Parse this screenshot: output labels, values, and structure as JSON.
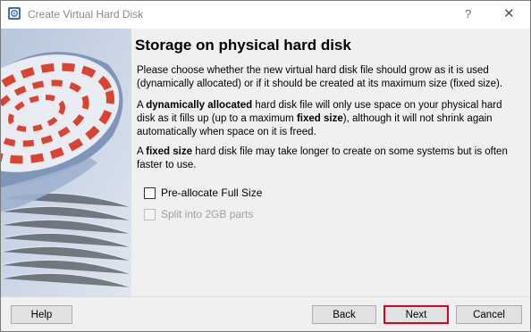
{
  "window": {
    "title": "Create Virtual Hard Disk",
    "help_glyph": "?",
    "close_glyph": "✕",
    "icon": "virtualbox-app-icon"
  },
  "page": {
    "heading": "Storage on physical hard disk",
    "paragraph1": "Please choose whether the new virtual hard disk file should grow as it is used (dynamically allocated) or if it should be created at its maximum size (fixed size).",
    "paragraph2": {
      "t1": "A ",
      "b1": "dynamically allocated",
      "t2": " hard disk file will only use space on your physical hard disk as it fills up (up to a maximum ",
      "b2": "fixed size",
      "t3": "), although it will not shrink again automatically when space on it is freed."
    },
    "paragraph3": {
      "t1": "A ",
      "b1": "fixed size",
      "t2": " hard disk file may take longer to create on some systems but is often faster to use."
    },
    "options": {
      "preallocate": {
        "label": "Pre-allocate Full Size",
        "checked": false,
        "enabled": true
      },
      "split": {
        "label": "Split into 2GB parts",
        "checked": false,
        "enabled": false
      }
    }
  },
  "buttons": {
    "help": "Help",
    "back": "Back",
    "next": "Next",
    "cancel": "Cancel"
  },
  "colors": {
    "highlight": "#e0001b",
    "disk_stripe": "#d9432f",
    "art_blue": "#8fa6c8"
  }
}
